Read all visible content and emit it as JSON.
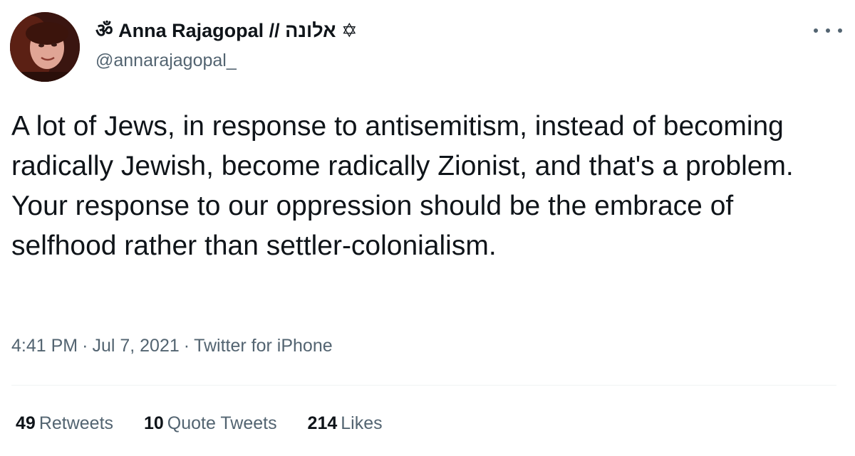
{
  "author": {
    "display_name": "ॐ Anna Rajagopal // אלונה ✡",
    "handle": "@annarajagopal_",
    "avatar_icon": "profile-photo"
  },
  "tweet": {
    "text": "A lot of Jews, in response to antisemitism, instead of becoming radically Jewish, become radically Zionist, and that's a problem. Your response to our oppression should be the embrace of selfhood rather than settler-colonialism."
  },
  "meta": {
    "time": "4:41 PM",
    "separator": "·",
    "date": "Jul 7, 2021",
    "source": "Twitter for iPhone"
  },
  "stats": {
    "retweets_count": "49",
    "retweets_label": "Retweets",
    "quotes_count": "10",
    "quotes_label": "Quote Tweets",
    "likes_count": "214",
    "likes_label": "Likes"
  },
  "colors": {
    "text_primary": "#0f1419",
    "text_secondary": "#536471",
    "divider": "#eff3f4"
  },
  "icons": {
    "more": "more-horizontal-icon"
  }
}
